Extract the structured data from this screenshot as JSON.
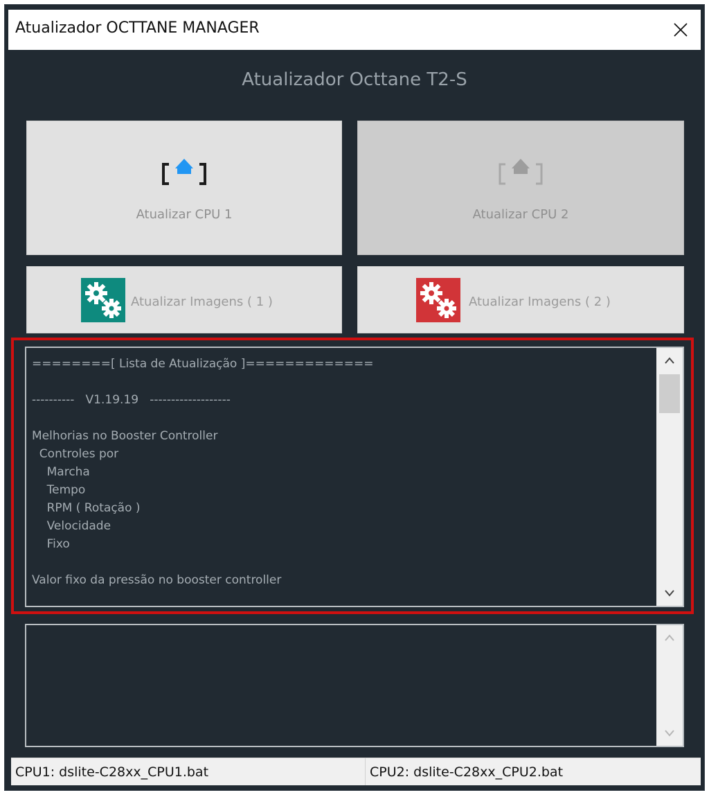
{
  "window": {
    "title": "Atualizador OCTTANE MANAGER"
  },
  "header": {
    "title": "Atualizador Octtane T2-S"
  },
  "buttons": {
    "cpu1": {
      "label": "Atualizar CPU 1",
      "icon": "upload-icon",
      "enabled": true
    },
    "cpu2": {
      "label": "Atualizar CPU 2",
      "icon": "upload-icon",
      "enabled": false
    },
    "img1": {
      "label": "Atualizar Imagens ( 1 )",
      "icon": "gears-icon",
      "color": "#0e8a7e"
    },
    "img2": {
      "label": "Atualizar Imagens ( 2 )",
      "icon": "gears-icon",
      "color": "#d13438"
    }
  },
  "changelog": {
    "lines": [
      "========[ Lista de Atualização ]=============",
      "",
      "----------   V1.19.19   -------------------",
      "",
      "Melhorias no Booster Controller",
      "  Controles por",
      "    Marcha",
      "    Tempo",
      "    RPM ( Rotação )",
      "    Velocidade",
      "    Fixo",
      "",
      "Valor fixo da pressão no booster controller"
    ]
  },
  "log": {
    "text": ""
  },
  "statusbar": {
    "cpu1": "CPU1: dslite-C28xx_CPU1.bat",
    "cpu2": "CPU2: dslite-C28xx_CPU2.bat"
  },
  "colors": {
    "background": "#212a32",
    "accent_blue": "#2196f3",
    "highlight_border": "#d01010"
  }
}
